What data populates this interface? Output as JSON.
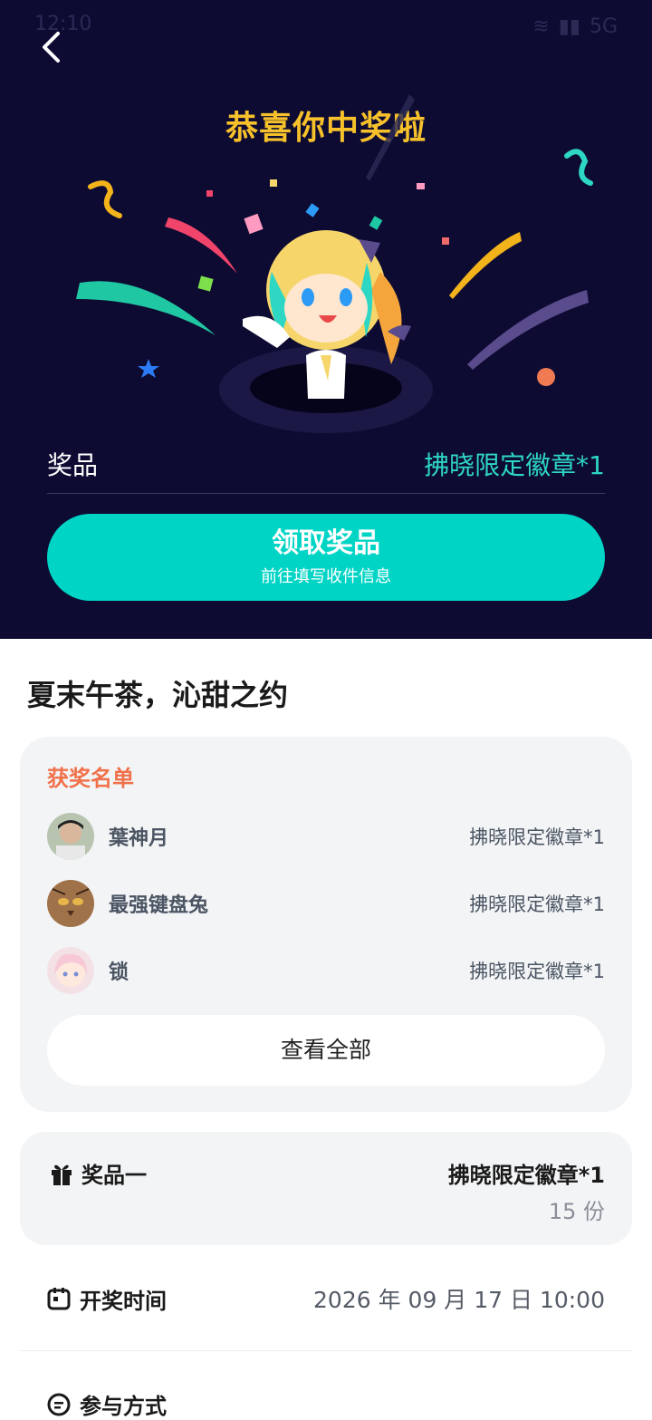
{
  "status_bar": {
    "time": "12:10",
    "right": "5G"
  },
  "hero": {
    "congrats": "恭喜你中奖啦",
    "prize_label": "奖品",
    "prize_value": "拂晓限定徽章*1",
    "claim_title": "领取奖品",
    "claim_sub": "前往填写收件信息"
  },
  "event": {
    "title": "夏末午茶，沁甜之约"
  },
  "winners": {
    "heading": "获奖名单",
    "items": [
      {
        "name": "葉神月",
        "prize": "拂晓限定徽章*1"
      },
      {
        "name": "最强键盘兔",
        "prize": "拂晓限定徽章*1"
      },
      {
        "name": "锁",
        "prize": "拂晓限定徽章*1"
      }
    ],
    "view_all": "查看全部"
  },
  "prize_card": {
    "label": "奖品一",
    "name": "拂晓限定徽章*1",
    "count": "15 份"
  },
  "draw_time": {
    "label": "开奖时间",
    "value": "2026 年 09 月 17 日 10:00"
  },
  "join": {
    "label": "参与方式"
  },
  "colors": {
    "hero_bg": "#0e0b33",
    "accent": "#00d4c5",
    "gold": "#f6c12a",
    "orange": "#f0714a"
  }
}
